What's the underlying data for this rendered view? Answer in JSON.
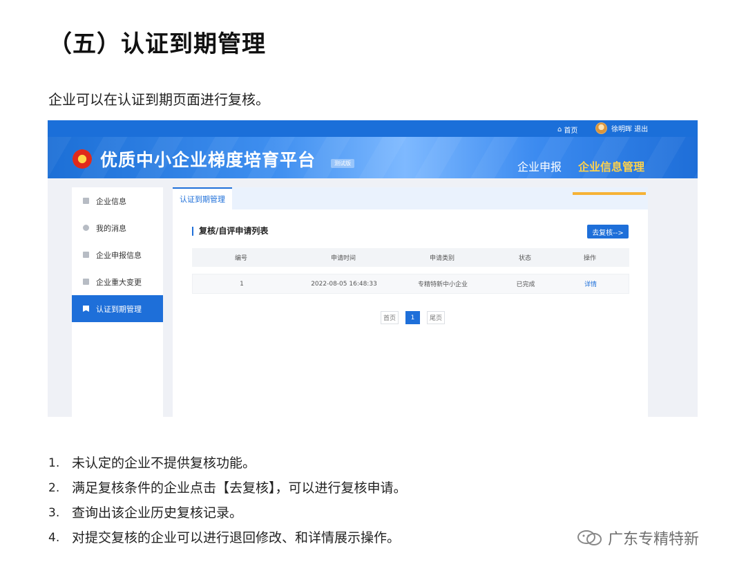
{
  "doc": {
    "heading": "（五）认证到期管理",
    "intro": "企业可以在认证到期页面进行复核。"
  },
  "app": {
    "top": {
      "home": "首页",
      "user": "徐明晖 退出"
    },
    "title": "优质中小企业梯度培育平台",
    "version_badge": "测试版",
    "nav": [
      "企业申报",
      "企业信息管理"
    ],
    "sidebar": [
      "企业信息",
      "我的消息",
      "企业申报信息",
      "企业重大变更",
      "认证到期管理"
    ],
    "tab": "认证到期管理",
    "section_title": "复核/自评申请列表",
    "go_button": "去复核-->",
    "table": {
      "headers": [
        "编号",
        "申请时间",
        "申请类别",
        "状态",
        "操作"
      ],
      "rows": [
        [
          "1",
          "2022-08-05 16:48:33",
          "专精特新中小企业",
          "已完成",
          "详情"
        ]
      ]
    },
    "pager": [
      "首页",
      "1",
      "尾页"
    ]
  },
  "notes": [
    "未认定的企业不提供复核功能。",
    "满足复核条件的企业点击【去复核】，可以进行复核申请。",
    "查询出该企业历史复核记录。",
    "对提交复核的企业可以进行退回修改、和详情展示操作。"
  ],
  "watermark": "广东专精特新",
  "colors": {
    "primary": "#1e6fd9",
    "active_nav": "#ffd24a",
    "nav_underline": "#f6b236"
  }
}
